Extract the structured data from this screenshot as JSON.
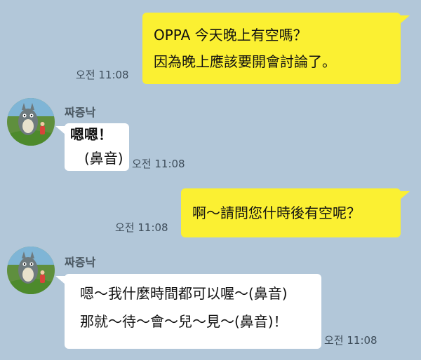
{
  "messages": [
    {
      "sender": "me",
      "lines": [
        "OPPA 今天晚上有空嗎？",
        "因為晚上應該要開會討論了。"
      ],
      "time": "오전 11:08"
    },
    {
      "sender": "짜증낙",
      "lines": [
        "嗯嗯！",
        "(鼻音)"
      ],
      "time": "오전 11:08"
    },
    {
      "sender": "me",
      "lines": [
        "啊～請問您什時後有空呢？"
      ],
      "time": "오전 11:08"
    },
    {
      "sender": "짜증낙",
      "lines": [
        "嗯～我什麼時間都可以喔～(鼻音)",
        "那就～待～會～兒～見～(鼻音)！"
      ],
      "time": "오전 11:08"
    }
  ],
  "contact": {
    "name": "짜증낙",
    "avatar_icon": "totoro-avatar-icon"
  },
  "colors": {
    "background": "#b2c7d9",
    "my_bubble": "#fbf032",
    "their_bubble": "#ffffff"
  }
}
